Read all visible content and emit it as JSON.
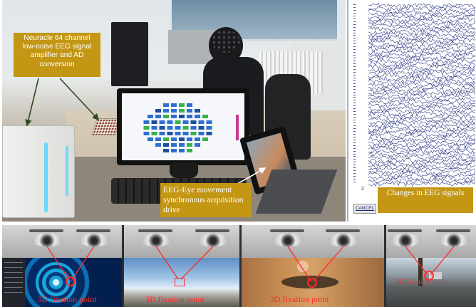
{
  "top_left_photo": {
    "captions": {
      "amplifier": "Neuracle 64 channel low-noise EEG signal amplifier and AD conversion",
      "acquisition": "EEG-Eye movement synchronous acquisition drive"
    }
  },
  "eeg_panel": {
    "channel_number": "2",
    "cancel_button": "CANCEL",
    "caption": "Changes in EEG signals",
    "trace_color": "#1d2a7a"
  },
  "bottom_strip": {
    "panels": [
      {
        "label": "3D fixation point"
      },
      {
        "label": "3D fixation point"
      },
      {
        "label": "3D fixation point"
      },
      {
        "label": "3D fixation point"
      }
    ],
    "marker_color": "#ff2a2a"
  },
  "colors": {
    "caption_bg": "#c39613",
    "caption_text": "#ffffff"
  }
}
